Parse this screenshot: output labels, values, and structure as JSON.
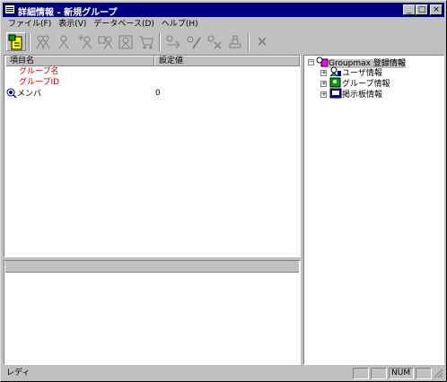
{
  "window": {
    "title": "詳細情報 - 新規グループ",
    "controls": {
      "minimize": "_",
      "maximize": "□",
      "close": "×"
    }
  },
  "menu": [
    {
      "label": "ファイル(F)"
    },
    {
      "label": "表示(V)"
    },
    {
      "label": "データベース(D)"
    },
    {
      "label": "ヘルプ(H)"
    }
  ],
  "toolbar": {
    "buttons": [
      {
        "icon": "new-document-icon",
        "enabled": true
      },
      {
        "icon": "users-icon",
        "enabled": false
      },
      {
        "icon": "user-icon",
        "enabled": false
      },
      {
        "icon": "add-user-icon",
        "enabled": false
      },
      {
        "icon": "group-user-icon",
        "enabled": false
      },
      {
        "icon": "group-grid-icon",
        "enabled": false
      },
      {
        "icon": "cart-icon",
        "enabled": false
      },
      {
        "icon": "transfer-icon",
        "enabled": false
      },
      {
        "icon": "edit-icon",
        "enabled": false
      },
      {
        "icon": "remove-icon",
        "enabled": false
      },
      {
        "icon": "stamp-icon",
        "enabled": false
      },
      {
        "icon": "delete-icon",
        "enabled": false,
        "glyph": "✕"
      }
    ]
  },
  "details": {
    "columns": {
      "name": "項目名",
      "value": "設定値"
    },
    "rows": [
      {
        "name": "グループ名",
        "value": "",
        "color": "#d00000"
      },
      {
        "name": "グループID",
        "value": "",
        "color": "#d00000"
      },
      {
        "name": "メンバ",
        "value": "0",
        "icon": "member-icon"
      }
    ]
  },
  "tree": {
    "root": {
      "label": "Groupmax 登録情報",
      "toggle": "−",
      "icon": "groupmax-icon"
    },
    "children": [
      {
        "label": "ユーザ情報",
        "toggle": "+",
        "icon": "user-info-icon"
      },
      {
        "label": "グループ情報",
        "toggle": "+",
        "icon": "group-info-icon"
      },
      {
        "label": "掲示板情報",
        "toggle": "+",
        "icon": "bulletin-icon"
      }
    ]
  },
  "status": {
    "text": "レディ",
    "indicators": [
      "",
      "",
      "NUM",
      ""
    ]
  }
}
